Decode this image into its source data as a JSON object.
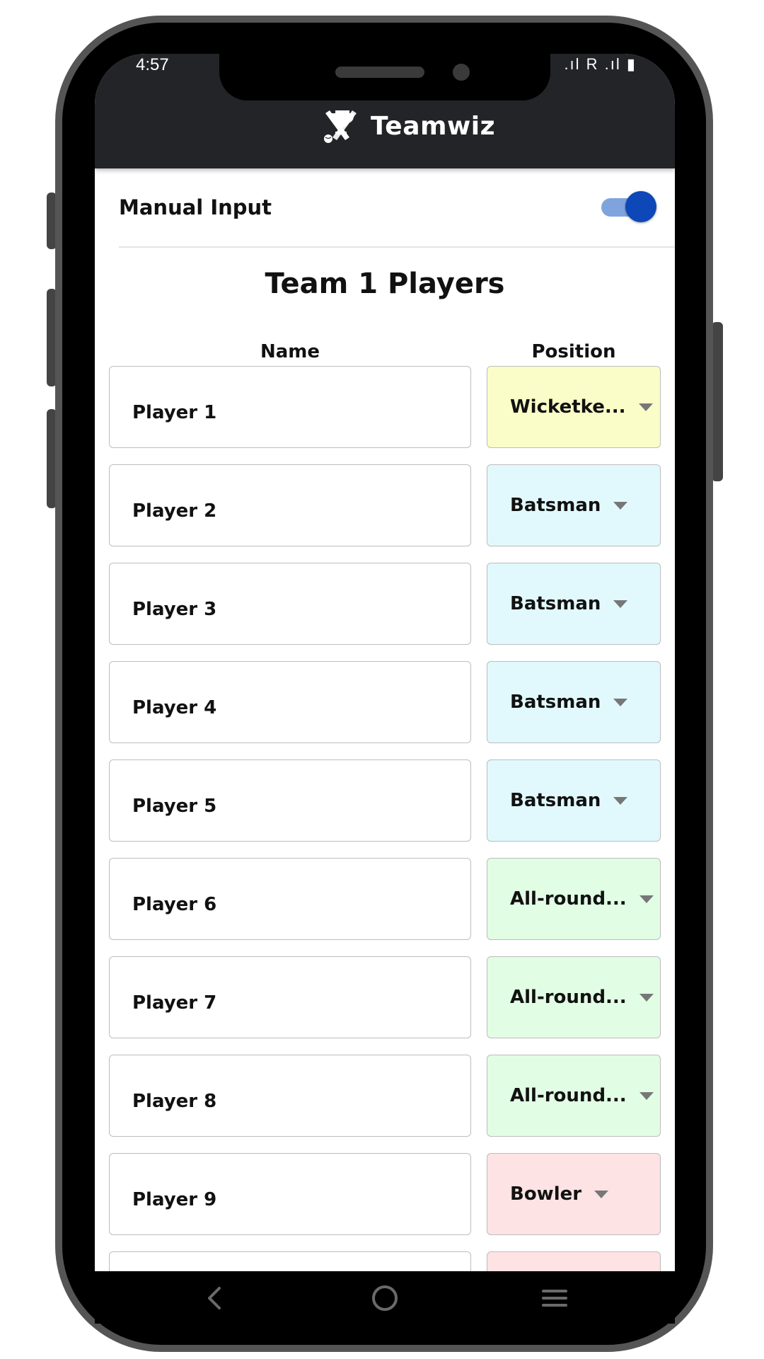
{
  "status_bar": {
    "time": "4:57",
    "right_indicators": ".ıl R .ıl ▮"
  },
  "app": {
    "name": "Teamwiz",
    "logo_icon": "trophy-cricket-icon"
  },
  "manual_input": {
    "label": "Manual Input",
    "enabled": true
  },
  "team": {
    "title": "Team 1 Players",
    "col_name": "Name",
    "col_position": "Position",
    "players": [
      {
        "name": "Player 1",
        "position": "Wicketke...",
        "color": "#fbfdc8"
      },
      {
        "name": "Player 2",
        "position": "Batsman",
        "color": "#e1f9fd"
      },
      {
        "name": "Player 3",
        "position": "Batsman",
        "color": "#e1f9fd"
      },
      {
        "name": "Player 4",
        "position": "Batsman",
        "color": "#e1f9fd"
      },
      {
        "name": "Player 5",
        "position": "Batsman",
        "color": "#e1f9fd"
      },
      {
        "name": "Player 6",
        "position": "All-round...",
        "color": "#e1fde4"
      },
      {
        "name": "Player 7",
        "position": "All-round...",
        "color": "#e1fde4"
      },
      {
        "name": "Player 8",
        "position": "All-round...",
        "color": "#e1fde4"
      },
      {
        "name": "Player 9",
        "position": "Bowler",
        "color": "#fde3e3"
      }
    ],
    "partial_next_row_color": "#fde3e3"
  },
  "nav": {
    "back_icon": "back-chevron-icon",
    "home_icon": "home-circle-icon",
    "menu_icon": "menu-lines-icon"
  }
}
